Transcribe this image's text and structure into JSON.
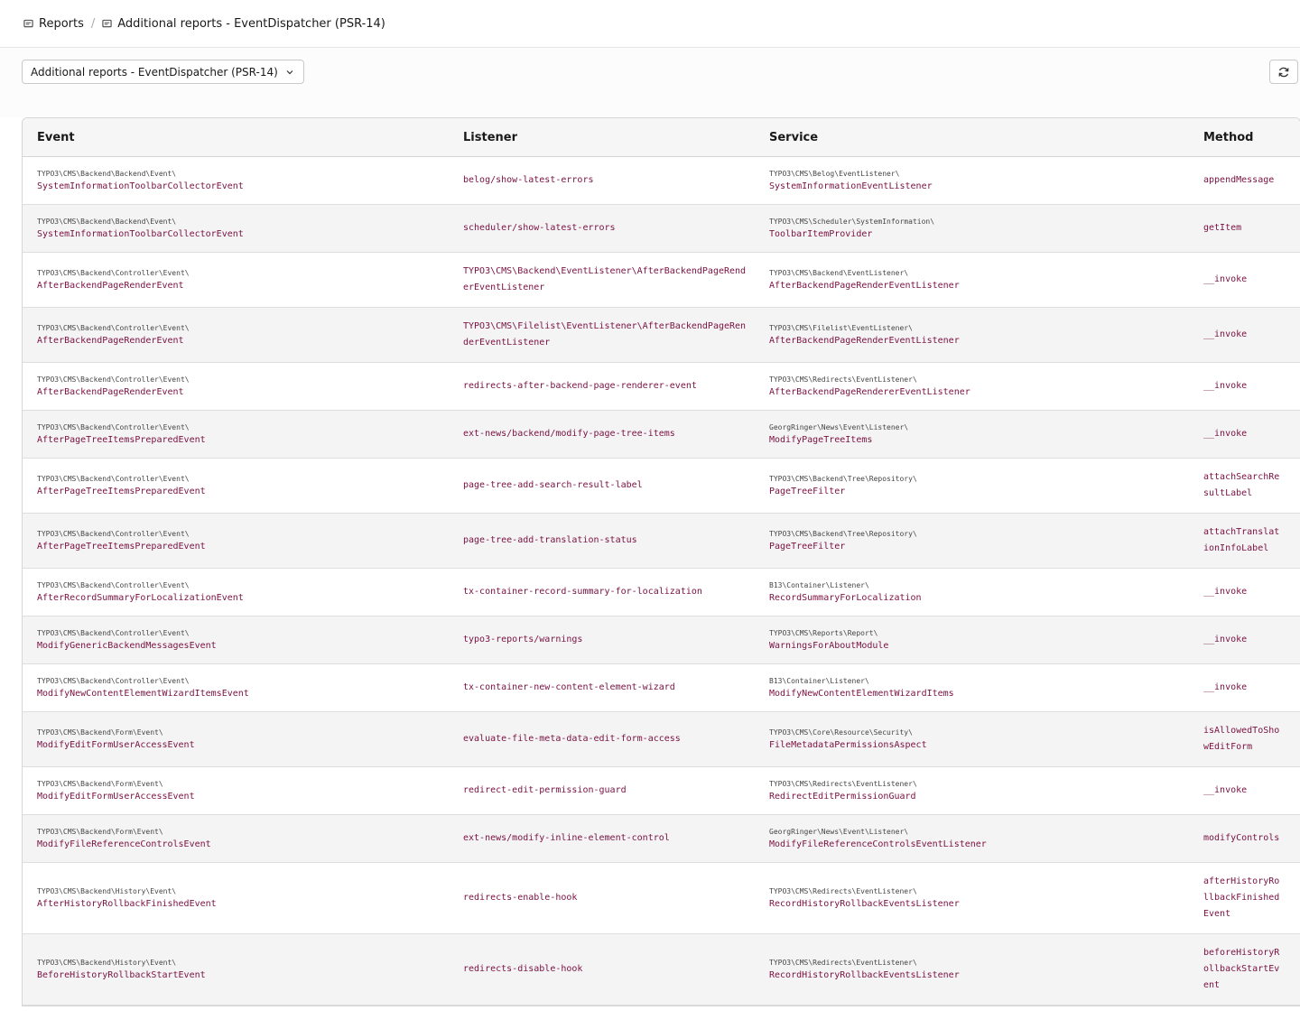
{
  "breadcrumb": {
    "root": "Reports",
    "current": "Additional reports - EventDispatcher (PSR-14)"
  },
  "dropdown": {
    "selected": "Additional reports - EventDispatcher (PSR-14)"
  },
  "table": {
    "headers": {
      "event": "Event",
      "listener": "Listener",
      "service": "Service",
      "method": "Method"
    },
    "rows": [
      {
        "event_ns": "TYPO3\\CMS\\Backend\\Backend\\Event\\",
        "event_cls": "SystemInformationToolbarCollectorEvent",
        "listener": "belog/show-latest-errors",
        "service_ns": "TYPO3\\CMS\\Belog\\EventListener\\",
        "service_cls": "SystemInformationEventListener",
        "method": "appendMessage"
      },
      {
        "event_ns": "TYPO3\\CMS\\Backend\\Backend\\Event\\",
        "event_cls": "SystemInformationToolbarCollectorEvent",
        "listener": "scheduler/show-latest-errors",
        "service_ns": "TYPO3\\CMS\\Scheduler\\SystemInformation\\",
        "service_cls": "ToolbarItemProvider",
        "method": "getItem"
      },
      {
        "event_ns": "TYPO3\\CMS\\Backend\\Controller\\Event\\",
        "event_cls": "AfterBackendPageRenderEvent",
        "listener": "TYPO3\\CMS\\Backend\\EventListener\\AfterBackendPageRenderEventListener",
        "service_ns": "TYPO3\\CMS\\Backend\\EventListener\\",
        "service_cls": "AfterBackendPageRenderEventListener",
        "method": "__invoke"
      },
      {
        "event_ns": "TYPO3\\CMS\\Backend\\Controller\\Event\\",
        "event_cls": "AfterBackendPageRenderEvent",
        "listener": "TYPO3\\CMS\\Filelist\\EventListener\\AfterBackendPageRenderEventListener",
        "service_ns": "TYPO3\\CMS\\Filelist\\EventListener\\",
        "service_cls": "AfterBackendPageRenderEventListener",
        "method": "__invoke"
      },
      {
        "event_ns": "TYPO3\\CMS\\Backend\\Controller\\Event\\",
        "event_cls": "AfterBackendPageRenderEvent",
        "listener": "redirects-after-backend-page-renderer-event",
        "service_ns": "TYPO3\\CMS\\Redirects\\EventListener\\",
        "service_cls": "AfterBackendPageRendererEventListener",
        "method": "__invoke"
      },
      {
        "event_ns": "TYPO3\\CMS\\Backend\\Controller\\Event\\",
        "event_cls": "AfterPageTreeItemsPreparedEvent",
        "listener": "ext-news/backend/modify-page-tree-items",
        "service_ns": "GeorgRinger\\News\\Event\\Listener\\",
        "service_cls": "ModifyPageTreeItems",
        "method": "__invoke"
      },
      {
        "event_ns": "TYPO3\\CMS\\Backend\\Controller\\Event\\",
        "event_cls": "AfterPageTreeItemsPreparedEvent",
        "listener": "page-tree-add-search-result-label",
        "service_ns": "TYPO3\\CMS\\Backend\\Tree\\Repository\\",
        "service_cls": "PageTreeFilter",
        "method": "attachSearchResultLabel"
      },
      {
        "event_ns": "TYPO3\\CMS\\Backend\\Controller\\Event\\",
        "event_cls": "AfterPageTreeItemsPreparedEvent",
        "listener": "page-tree-add-translation-status",
        "service_ns": "TYPO3\\CMS\\Backend\\Tree\\Repository\\",
        "service_cls": "PageTreeFilter",
        "method": "attachTranslationInfoLabel"
      },
      {
        "event_ns": "TYPO3\\CMS\\Backend\\Controller\\Event\\",
        "event_cls": "AfterRecordSummaryForLocalizationEvent",
        "listener": "tx-container-record-summary-for-localization",
        "service_ns": "B13\\Container\\Listener\\",
        "service_cls": "RecordSummaryForLocalization",
        "method": "__invoke"
      },
      {
        "event_ns": "TYPO3\\CMS\\Backend\\Controller\\Event\\",
        "event_cls": "ModifyGenericBackendMessagesEvent",
        "listener": "typo3-reports/warnings",
        "service_ns": "TYPO3\\CMS\\Reports\\Report\\",
        "service_cls": "WarningsForAboutModule",
        "method": "__invoke"
      },
      {
        "event_ns": "TYPO3\\CMS\\Backend\\Controller\\Event\\",
        "event_cls": "ModifyNewContentElementWizardItemsEvent",
        "listener": "tx-container-new-content-element-wizard",
        "service_ns": "B13\\Container\\Listener\\",
        "service_cls": "ModifyNewContentElementWizardItems",
        "method": "__invoke"
      },
      {
        "event_ns": "TYPO3\\CMS\\Backend\\Form\\Event\\",
        "event_cls": "ModifyEditFormUserAccessEvent",
        "listener": "evaluate-file-meta-data-edit-form-access",
        "service_ns": "TYPO3\\CMS\\Core\\Resource\\Security\\",
        "service_cls": "FileMetadataPermissionsAspect",
        "method": "isAllowedToShowEditForm"
      },
      {
        "event_ns": "TYPO3\\CMS\\Backend\\Form\\Event\\",
        "event_cls": "ModifyEditFormUserAccessEvent",
        "listener": "redirect-edit-permission-guard",
        "service_ns": "TYPO3\\CMS\\Redirects\\EventListener\\",
        "service_cls": "RedirectEditPermissionGuard",
        "method": "__invoke"
      },
      {
        "event_ns": "TYPO3\\CMS\\Backend\\Form\\Event\\",
        "event_cls": "ModifyFileReferenceControlsEvent",
        "listener": "ext-news/modify-inline-element-control",
        "service_ns": "GeorgRinger\\News\\Event\\Listener\\",
        "service_cls": "ModifyFileReferenceControlsEventListener",
        "method": "modifyControls"
      },
      {
        "event_ns": "TYPO3\\CMS\\Backend\\History\\Event\\",
        "event_cls": "AfterHistoryRollbackFinishedEvent",
        "listener": "redirects-enable-hook",
        "service_ns": "TYPO3\\CMS\\Redirects\\EventListener\\",
        "service_cls": "RecordHistoryRollbackEventsListener",
        "method": "afterHistoryRollbackFinishedEvent"
      },
      {
        "event_ns": "TYPO3\\CMS\\Backend\\History\\Event\\",
        "event_cls": "BeforeHistoryRollbackStartEvent",
        "listener": "redirects-disable-hook",
        "service_ns": "TYPO3\\CMS\\Redirects\\EventListener\\",
        "service_cls": "RecordHistoryRollbackEventsListener",
        "method": "beforeHistoryRollbackStartEvent"
      }
    ]
  }
}
